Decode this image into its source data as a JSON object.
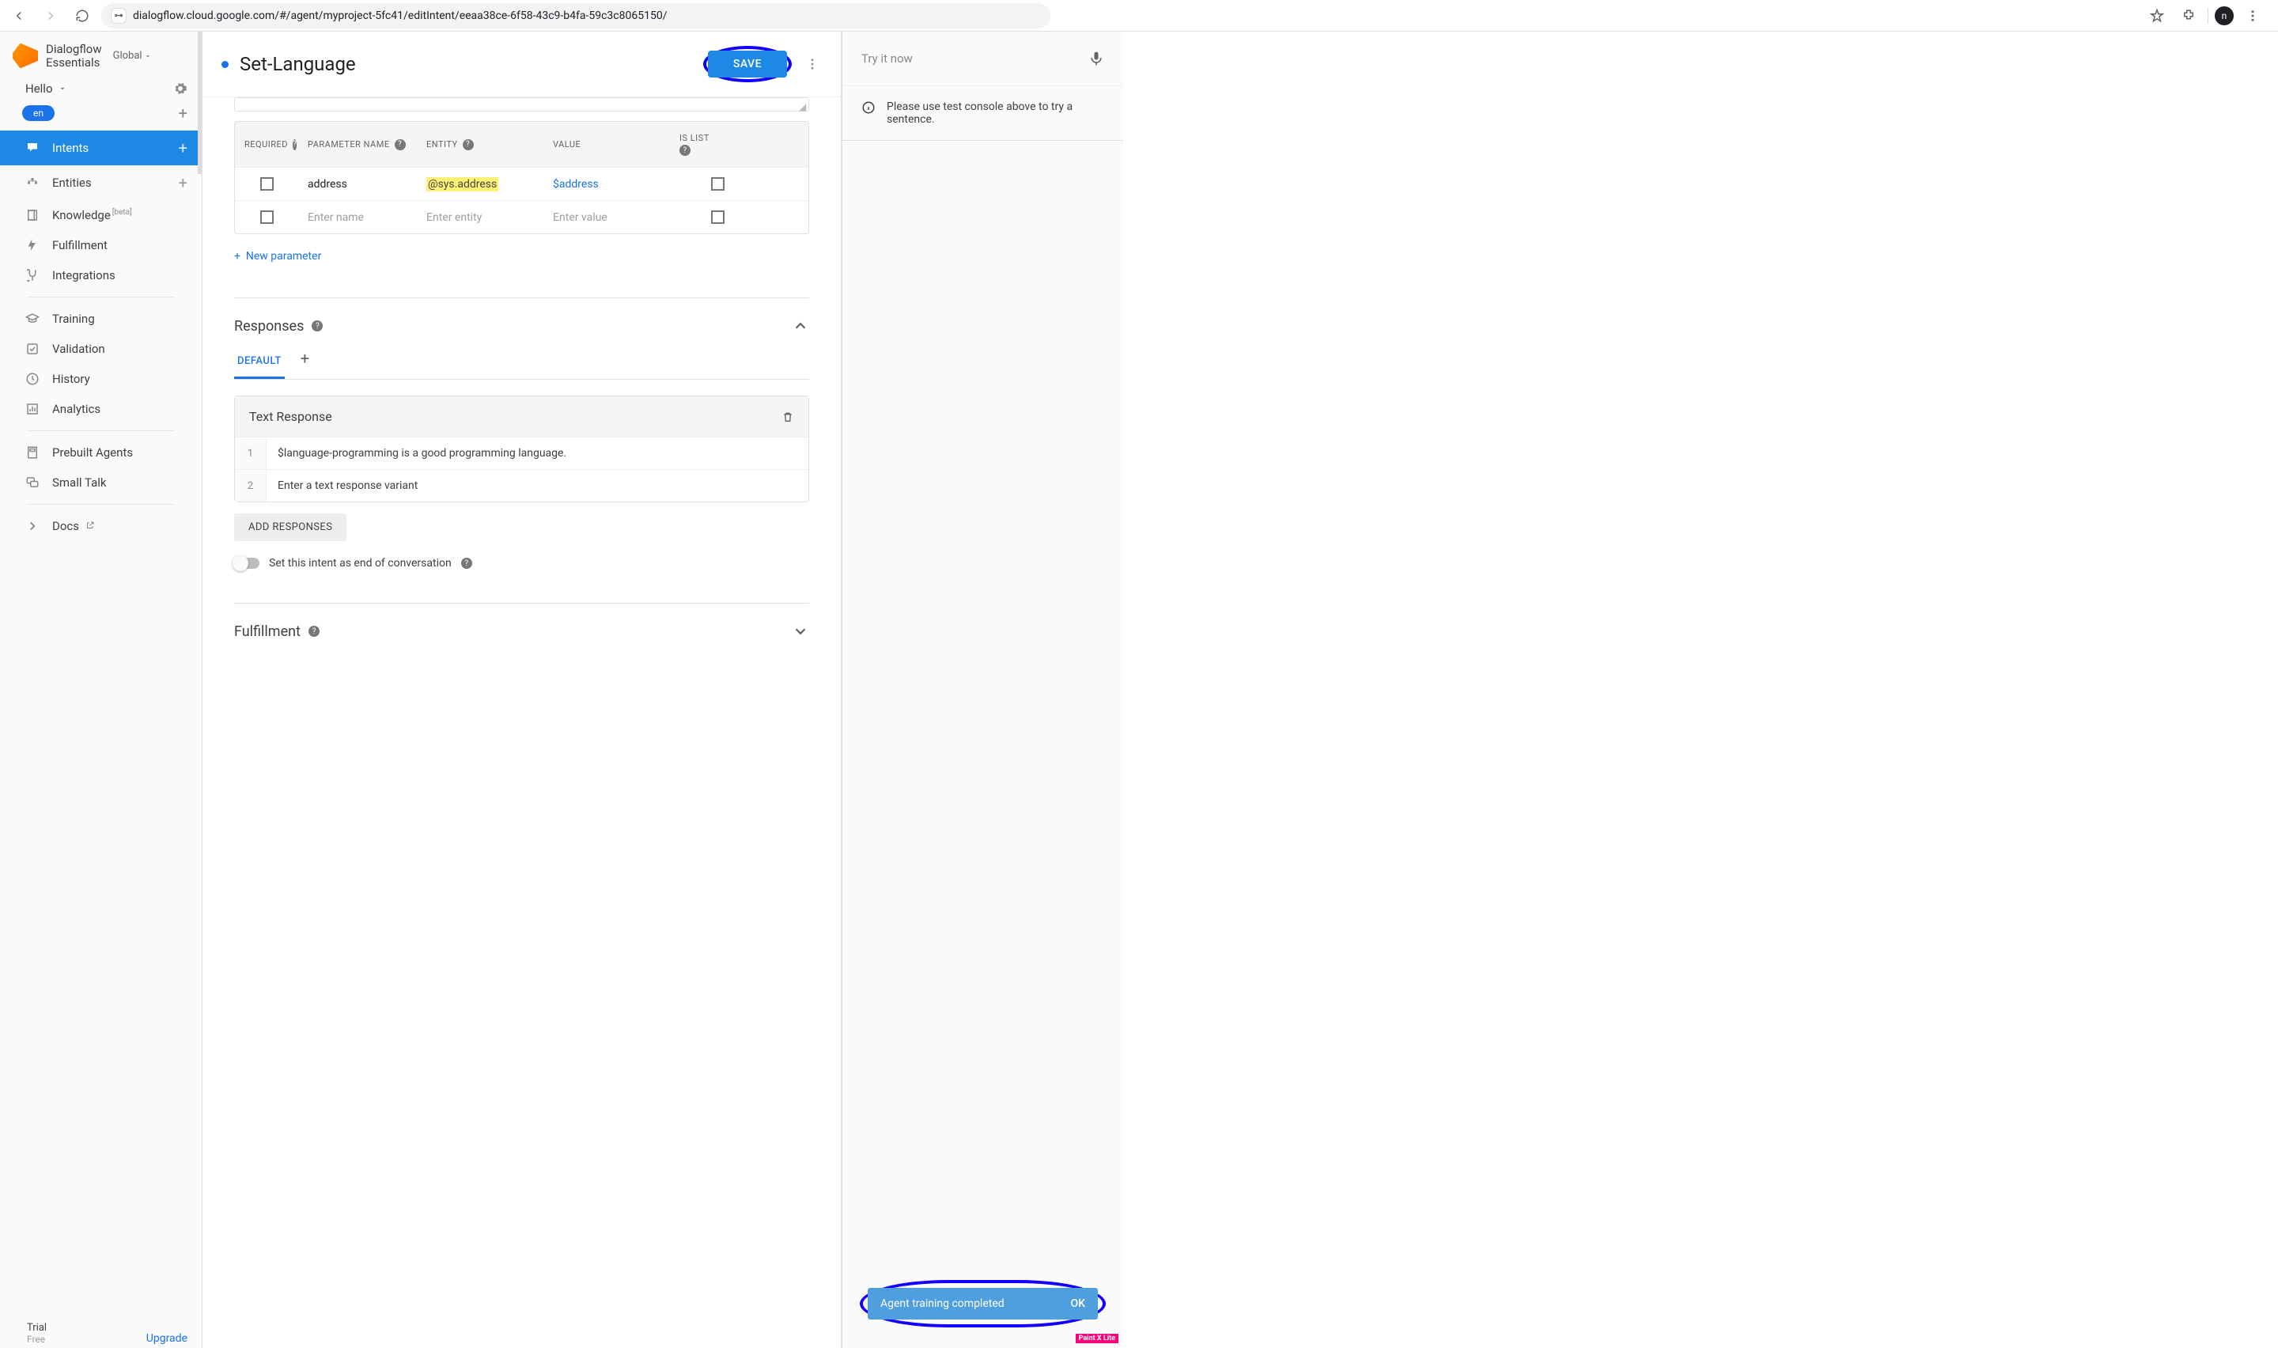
{
  "browser": {
    "url": "dialogflow.cloud.google.com/#/agent/myproject-5fc41/editIntent/eeaa38ce-6f58-43c9-b4fa-59c3c8065150/",
    "avatar_letter": "n"
  },
  "brand": {
    "line1": "Dialogflow",
    "line2": "Essentials",
    "scope": "Global"
  },
  "agent": {
    "name": "Hello",
    "lang": "en"
  },
  "sidebar": {
    "intents": "Intents",
    "entities": "Entities",
    "knowledge": "Knowledge",
    "knowledge_badge": "[beta]",
    "fulfillment": "Fulfillment",
    "integrations": "Integrations",
    "training": "Training",
    "validation": "Validation",
    "history": "History",
    "analytics": "Analytics",
    "prebuilt": "Prebuilt Agents",
    "smalltalk": "Small Talk",
    "docs": "Docs",
    "trial": "Trial",
    "free": "Free",
    "upgrade": "Upgrade"
  },
  "intent": {
    "title": "Set-Language",
    "save": "SAVE"
  },
  "params": {
    "th_required": "REQUIRED",
    "th_name": "PARAMETER NAME",
    "th_entity": "ENTITY",
    "th_value": "VALUE",
    "th_islist": "IS LIST",
    "row1_name": "address",
    "row1_entity": "@sys.address",
    "row1_value": "$address",
    "ph_name": "Enter name",
    "ph_entity": "Enter entity",
    "ph_value": "Enter value",
    "new_param": "New parameter"
  },
  "responses": {
    "section": "Responses",
    "tab_default": "DEFAULT",
    "card_title": "Text Response",
    "r1": "$language-programming is a good programming language.",
    "r2_ph": "Enter a text response variant",
    "add_btn": "ADD RESPONSES",
    "end_conv": "Set this intent as end of conversation"
  },
  "fulfillment": {
    "section": "Fulfillment"
  },
  "right": {
    "try": "Try it now",
    "hint": "Please use test console above to try a sentence.",
    "toast_msg": "Agent training completed",
    "toast_ok": "OK",
    "watermark": "Paint X Lite"
  }
}
